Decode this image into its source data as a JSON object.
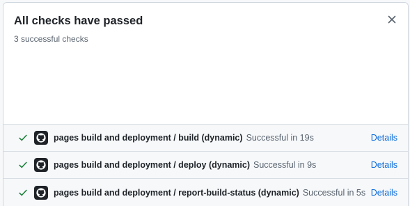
{
  "header": {
    "title": "All checks have passed",
    "subtitle": "3 successful checks"
  },
  "close_icon": "x-icon",
  "colors": {
    "success": "#1a7f37",
    "link": "#0969da",
    "text_primary": "#1f2328",
    "text_muted": "#59636e"
  },
  "checks": [
    {
      "name": "pages build and deployment / build (dynamic)",
      "status": "Successful in 19s",
      "details_label": "Details",
      "icon": "github-icon"
    },
    {
      "name": "pages build and deployment / deploy (dynamic)",
      "status": "Successful in 9s",
      "details_label": "Details",
      "icon": "github-icon"
    },
    {
      "name": "pages build and deployment / report-build-status (dynamic)",
      "status": "Successful in 5s",
      "details_label": "Details",
      "icon": "github-icon"
    }
  ]
}
